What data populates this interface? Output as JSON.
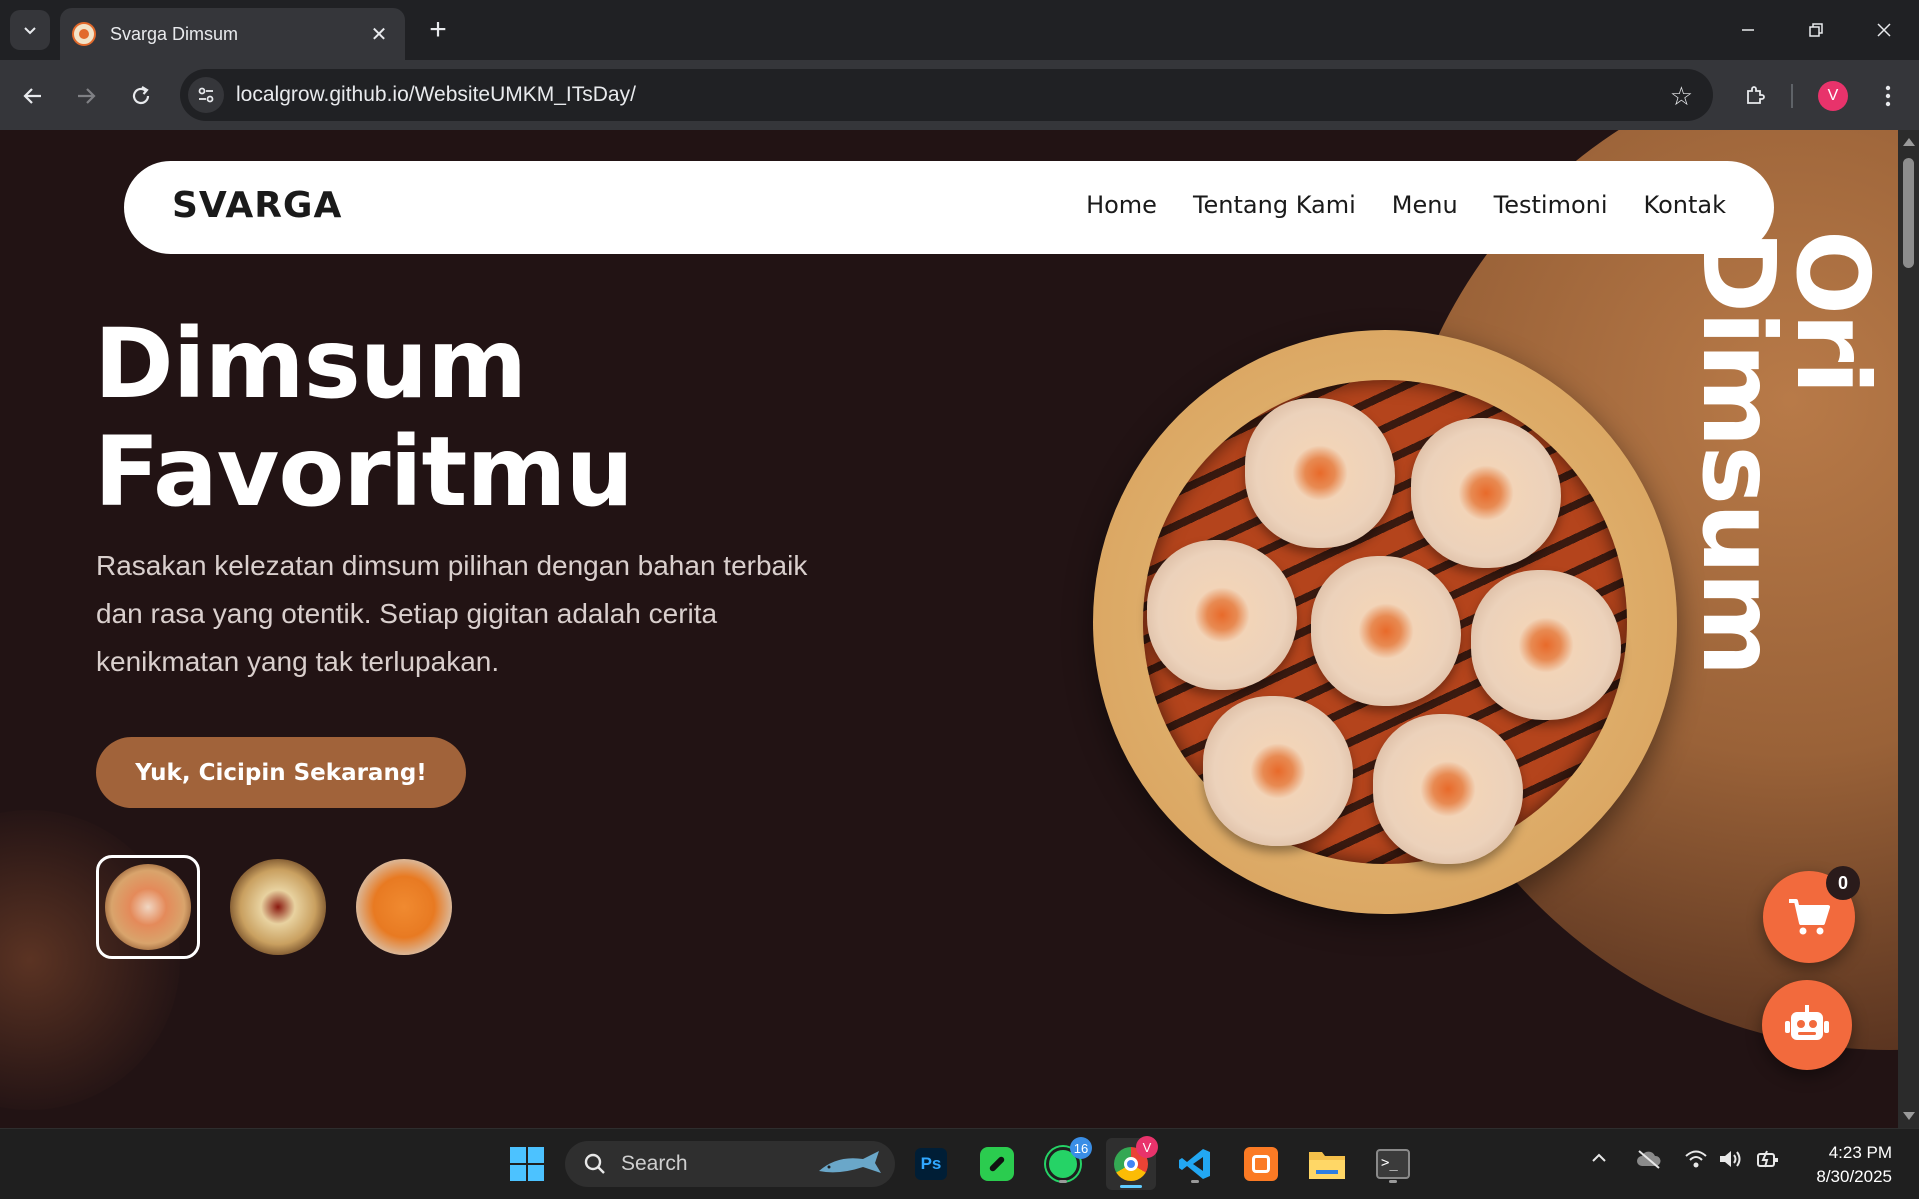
{
  "browser": {
    "tab_title": "Svarga Dimsum",
    "url": "localgrow.github.io/WebsiteUMKM_ITsDay/",
    "profile_initial": "V"
  },
  "page": {
    "brand": "SVARGA",
    "nav": [
      "Home",
      "Tentang Kami",
      "Menu",
      "Testimoni",
      "Kontak"
    ],
    "vertical_words": [
      "Dimsum",
      "Ori"
    ],
    "hero_title_line1": "Dimsum",
    "hero_title_line2": "Favoritmu",
    "hero_description": "Rasakan kelezatan dimsum pilihan dengan bahan terbaik dan rasa yang otentik. Setiap gigitan adalah cerita kenikmatan yang tak terlupakan.",
    "cta_label": "Yuk, Cicipin Sekarang!",
    "thumbnails": [
      "shumai-thumbnail",
      "gyoza-thumbnail",
      "carrot-dimsum-thumbnail"
    ],
    "cart_count": "0"
  },
  "taskbar": {
    "search_label": "Search",
    "whatsapp_badge": "16",
    "chrome_badge": "V",
    "time": "4:23 PM",
    "date": "8/30/2025"
  },
  "colors": {
    "page_bg": "#221314",
    "accent_brown": "#a1633a",
    "accent_orange": "#f26a3d"
  }
}
